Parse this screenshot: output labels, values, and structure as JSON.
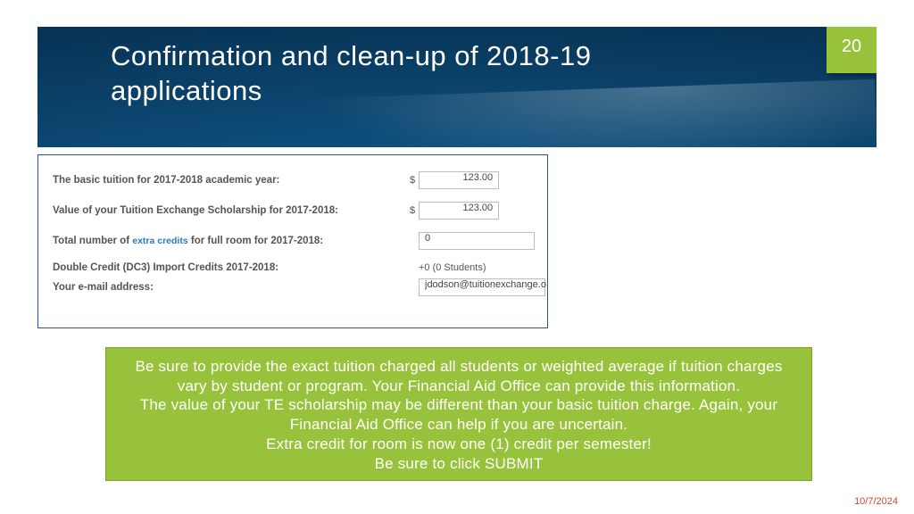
{
  "header": {
    "title": "Confirmation and clean-up of 2018-19 applications",
    "page_number": "20"
  },
  "form": {
    "tuition_label": "The basic tuition for 2017-2018 academic year:",
    "tuition_currency": "$",
    "tuition_value": "123.00",
    "scholarship_label": "Value of your Tuition Exchange Scholarship for 2017-2018:",
    "scholarship_currency": "$",
    "scholarship_value": "123.00",
    "extra_credits_label_pre": "Total number of ",
    "extra_credits_link": "extra credits",
    "extra_credits_label_post": " for full room for 2017-2018:",
    "extra_credits_value": "0",
    "dc3_label": "Double Credit (DC3) Import Credits 2017-2018:",
    "dc3_value": "+0 (0 Students)",
    "email_label": "Your e-mail address:",
    "email_value": "jdodson@tuitionexchange.o"
  },
  "callout": {
    "line1": "Be sure to provide the exact tuition charged all students or weighted average if tuition charges vary by student or program.  Your Financial Aid Office can provide this information.",
    "line2": "The value of your TE scholarship may be different than your basic tuition charge.  Again, your Financial Aid Office can help if you are uncertain.",
    "line3": "Extra credit for room is now one (1) credit per semester!",
    "line4": "Be sure to click SUBMIT"
  },
  "footer": {
    "date": "10/7/2024"
  }
}
